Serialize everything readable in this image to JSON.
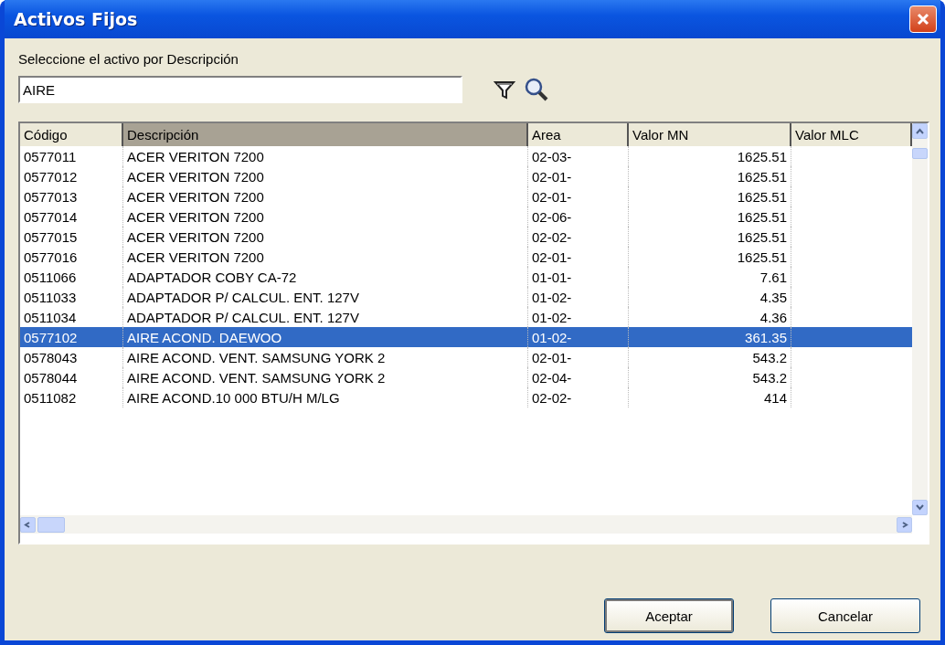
{
  "window": {
    "title": "Activos Fijos"
  },
  "search": {
    "label": "Seleccione el activo por Descripción",
    "value": "AIRE"
  },
  "table": {
    "columns": [
      {
        "label": "Código",
        "sorted": false
      },
      {
        "label": "Descripción",
        "sorted": true
      },
      {
        "label": "Area",
        "sorted": false
      },
      {
        "label": "Valor MN",
        "sorted": false
      },
      {
        "label": "Valor MLC",
        "sorted": false
      }
    ],
    "rows": [
      {
        "cells": [
          "0577011",
          "ACER VERITON 7200",
          "02-03-",
          "1625.51"
        ],
        "selected": false
      },
      {
        "cells": [
          "0577012",
          "ACER VERITON 7200",
          "02-01-",
          "1625.51"
        ],
        "selected": false
      },
      {
        "cells": [
          "0577013",
          "ACER VERITON 7200",
          "02-01-",
          "1625.51"
        ],
        "selected": false
      },
      {
        "cells": [
          "0577014",
          "ACER VERITON 7200",
          "02-06-",
          "1625.51"
        ],
        "selected": false
      },
      {
        "cells": [
          "0577015",
          "ACER VERITON 7200",
          "02-02-",
          "1625.51"
        ],
        "selected": false
      },
      {
        "cells": [
          "0577016",
          "ACER VERITON 7200",
          "02-01-",
          "1625.51"
        ],
        "selected": false
      },
      {
        "cells": [
          "0511066",
          "ADAPTADOR COBY CA-72",
          "01-01-",
          "7.61"
        ],
        "selected": false
      },
      {
        "cells": [
          "0511033",
          "ADAPTADOR P/ CALCUL. ENT. 127V",
          "01-02-",
          "4.35"
        ],
        "selected": false
      },
      {
        "cells": [
          "0511034",
          "ADAPTADOR P/ CALCUL. ENT. 127V",
          "01-02-",
          "4.36"
        ],
        "selected": false
      },
      {
        "cells": [
          "0577102",
          "AIRE ACOND. DAEWOO",
          "01-02-",
          "361.35"
        ],
        "selected": true
      },
      {
        "cells": [
          "0578043",
          "AIRE ACOND. VENT. SAMSUNG YORK 2",
          "02-01-",
          "543.2"
        ],
        "selected": false
      },
      {
        "cells": [
          "0578044",
          "AIRE ACOND. VENT. SAMSUNG YORK 2",
          "02-04-",
          "543.2"
        ],
        "selected": false
      },
      {
        "cells": [
          "0511082",
          "AIRE ACOND.10 000 BTU/H M/LG",
          "02-02-",
          "414"
        ],
        "selected": false
      }
    ]
  },
  "buttons": [
    {
      "label": "Aceptar",
      "default": true
    },
    {
      "label": "Cancelar",
      "default": false
    }
  ]
}
